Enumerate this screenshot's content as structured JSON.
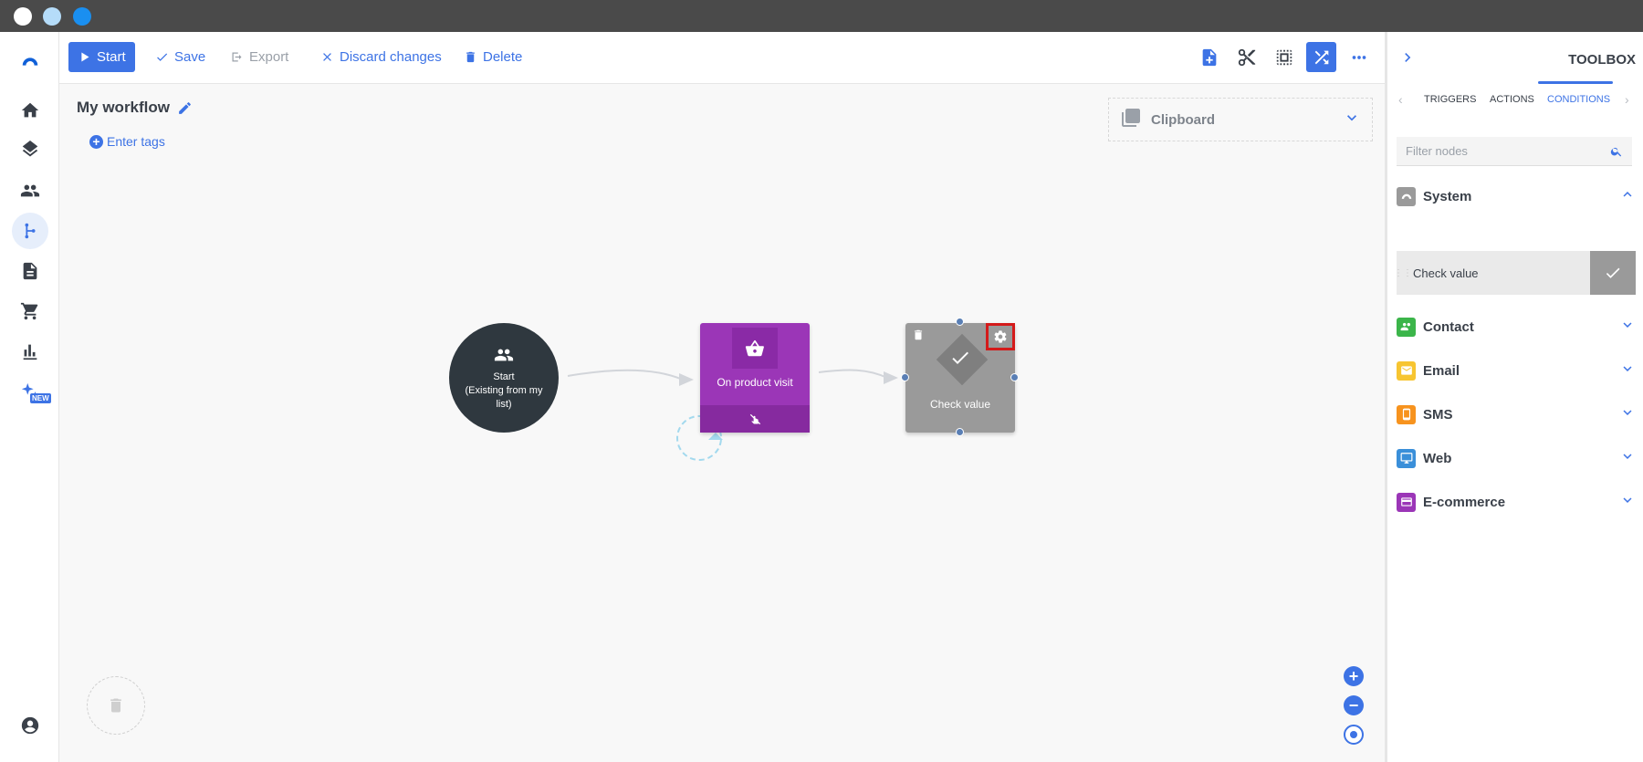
{
  "toolbar": {
    "start_label": "Start",
    "save_label": "Save",
    "export_label": "Export",
    "discard_label": "Discard changes",
    "delete_label": "Delete"
  },
  "nav": {
    "new_badge": "NEW"
  },
  "workflow": {
    "title": "My workflow",
    "tags_label": "Enter tags"
  },
  "clipboard": {
    "label": "Clipboard"
  },
  "nodes": {
    "start_title": "Start",
    "start_subtitle": "(Existing from my list)",
    "visit_label": "On product visit",
    "check_label": "Check value"
  },
  "toolbox": {
    "title": "TOOLBOX",
    "tabs": [
      "TRIGGERS",
      "ACTIONS",
      "CONDITIONS"
    ],
    "active_tab": "CONDITIONS",
    "filter_placeholder": "Filter nodes",
    "categories": [
      {
        "label": "System",
        "color": "#9a9a9a",
        "expanded": true
      },
      {
        "label": "Contact",
        "color": "#3bb54a"
      },
      {
        "label": "Email",
        "color": "#f7c531"
      },
      {
        "label": "SMS",
        "color": "#f7931e"
      },
      {
        "label": "Web",
        "color": "#3a8fd9"
      },
      {
        "label": "E-commerce",
        "color": "#9b36b7"
      }
    ],
    "system_item": "Check value"
  },
  "colors": {
    "accent": "#3d73e5",
    "visit_node": "#9b36b7",
    "check_node": "#9a9a9a",
    "start_node": "#2f383f",
    "highlight": "#d41a1a"
  }
}
